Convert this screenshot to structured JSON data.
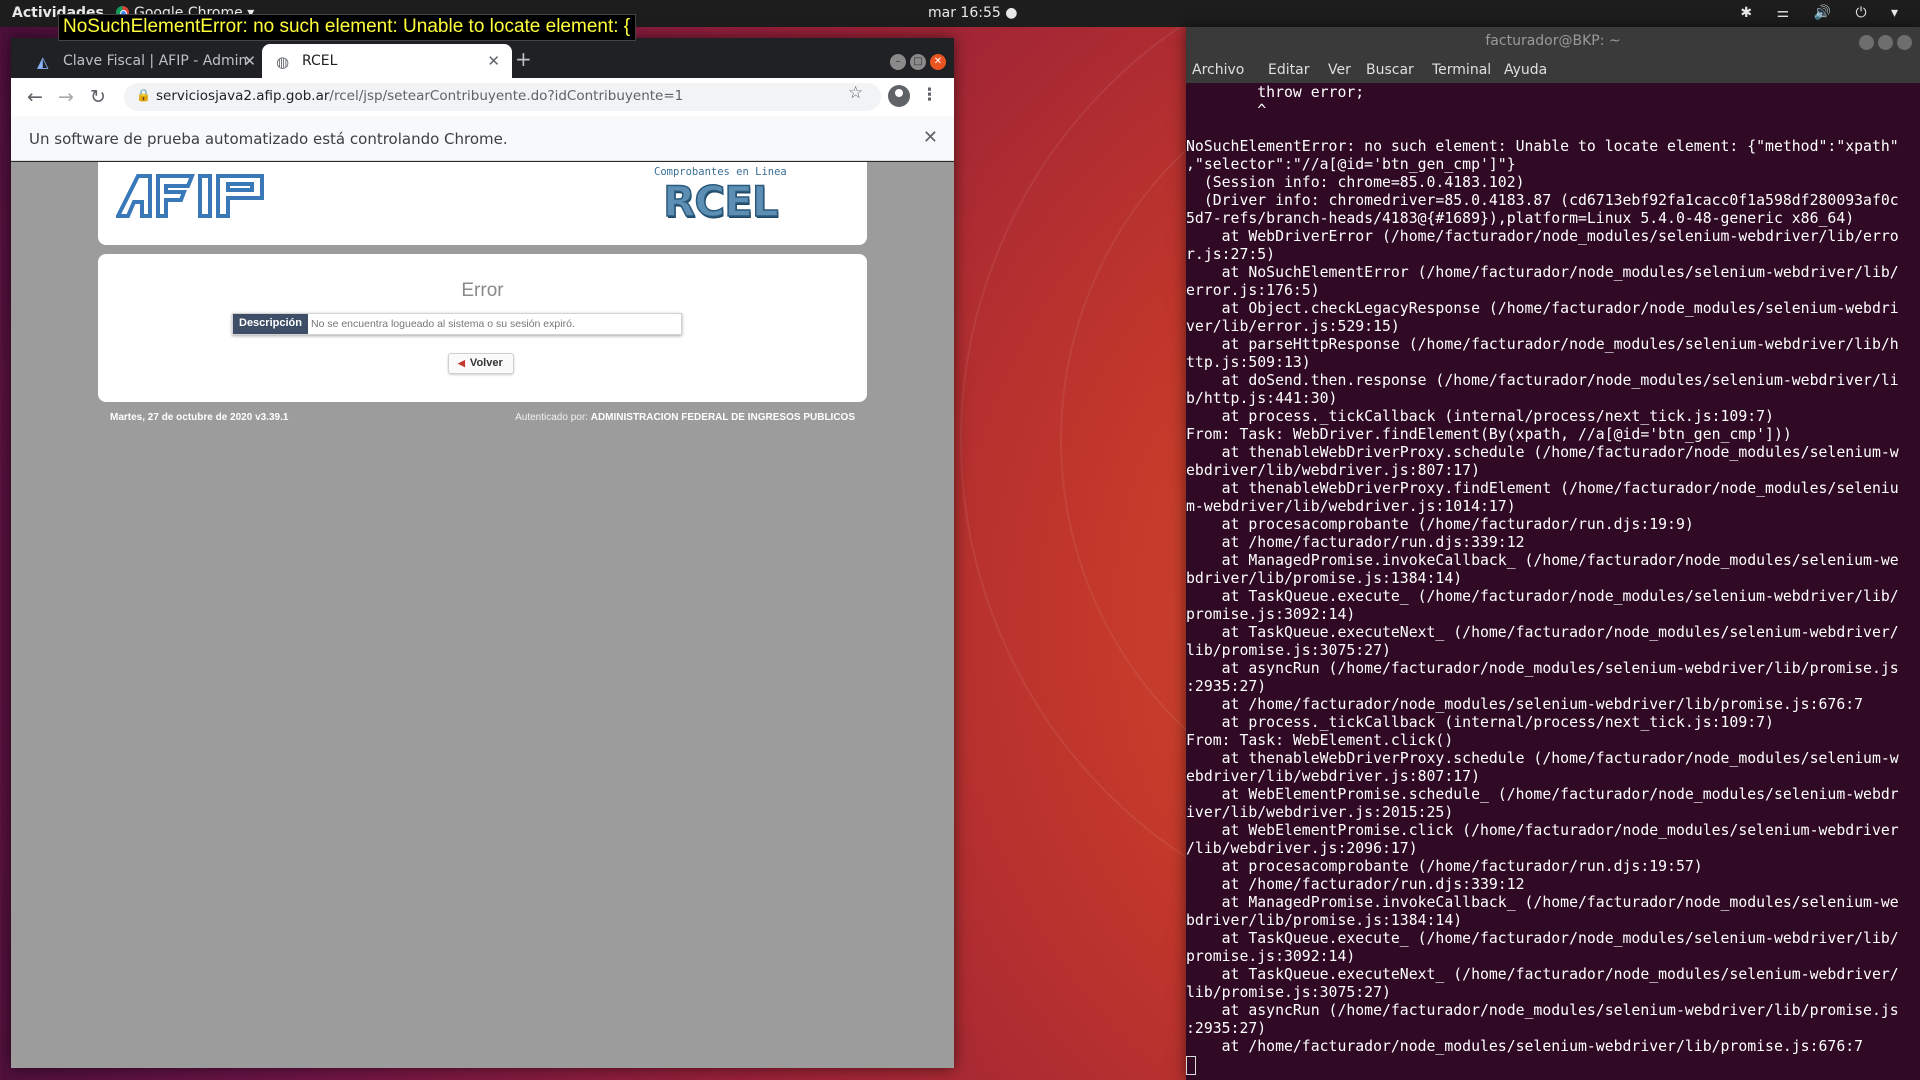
{
  "topbar": {
    "activities": "Actividades",
    "app_name": "Google Chrome",
    "clock": "mar 16:55 ●",
    "status_icons": "✱ ⚌ 🔊 ⏻ ▾"
  },
  "tooltip": "NoSuchElementError: no such element: Unable to locate element: {",
  "chrome": {
    "tabs": [
      {
        "label": "Clave Fiscal | AFIP - Admin",
        "close": "✕"
      },
      {
        "label": "RCEL",
        "close": "✕"
      }
    ],
    "new_tab": "+",
    "url_host": "serviciosjava2.afip.gob.ar",
    "url_path": "/rcel/jsp/setearContribuyente.do?idContribuyente=1",
    "infobar": "Un software de prueba automatizado está controlando Chrome.",
    "infobar_close": "✕"
  },
  "page": {
    "rcel_caption": "Comprobantes en Linea",
    "rcel_word": "RCEL",
    "error_title": "Error",
    "desc_label": "Descripción",
    "desc_text": "No se encuentra logueado al sistema o su sesión expiró.",
    "volver": "Volver",
    "footer_date": "Martes, 27 de octubre de 2020 v3.39.1",
    "footer_auth_prefix": "Autenticado por:",
    "footer_auth_org": "ADMINISTRACION FEDERAL DE INGRESOS PUBLICOS"
  },
  "terminal": {
    "title": "facturador@BKP: ~",
    "menu": [
      "Archivo",
      "Editar",
      "Ver",
      "Buscar",
      "Terminal",
      "Ayuda"
    ],
    "lines": [
      "        throw error;",
      "        ^",
      "",
      "NoSuchElementError: no such element: Unable to locate element: {\"method\":\"xpath\"",
      ",\"selector\":\"//a[@id='btn_gen_cmp']\"}",
      "  (Session info: chrome=85.0.4183.102)",
      "  (Driver info: chromedriver=85.0.4183.87 (cd6713ebf92fa1cacc0f1a598df280093af0c",
      "5d7-refs/branch-heads/4183@{#1689}),platform=Linux 5.4.0-48-generic x86_64)",
      "    at WebDriverError (/home/facturador/node_modules/selenium-webdriver/lib/erro",
      "r.js:27:5)",
      "    at NoSuchElementError (/home/facturador/node_modules/selenium-webdriver/lib/",
      "error.js:176:5)",
      "    at Object.checkLegacyResponse (/home/facturador/node_modules/selenium-webdri",
      "ver/lib/error.js:529:15)",
      "    at parseHttpResponse (/home/facturador/node_modules/selenium-webdriver/lib/h",
      "ttp.js:509:13)",
      "    at doSend.then.response (/home/facturador/node_modules/selenium-webdriver/li",
      "b/http.js:441:30)",
      "    at process._tickCallback (internal/process/next_tick.js:109:7)",
      "From: Task: WebDriver.findElement(By(xpath, //a[@id='btn_gen_cmp']))",
      "    at thenableWebDriverProxy.schedule (/home/facturador/node_modules/selenium-w",
      "ebdriver/lib/webdriver.js:807:17)",
      "    at thenableWebDriverProxy.findElement (/home/facturador/node_modules/seleniu",
      "m-webdriver/lib/webdriver.js:1014:17)",
      "    at procesacomprobante (/home/facturador/run.djs:19:9)",
      "    at /home/facturador/run.djs:339:12",
      "    at ManagedPromise.invokeCallback_ (/home/facturador/node_modules/selenium-we",
      "bdriver/lib/promise.js:1384:14)",
      "    at TaskQueue.execute_ (/home/facturador/node_modules/selenium-webdriver/lib/",
      "promise.js:3092:14)",
      "    at TaskQueue.executeNext_ (/home/facturador/node_modules/selenium-webdriver/",
      "lib/promise.js:3075:27)",
      "    at asyncRun (/home/facturador/node_modules/selenium-webdriver/lib/promise.js",
      ":2935:27)",
      "    at /home/facturador/node_modules/selenium-webdriver/lib/promise.js:676:7",
      "    at process._tickCallback (internal/process/next_tick.js:109:7)",
      "From: Task: WebElement.click()",
      "    at thenableWebDriverProxy.schedule (/home/facturador/node_modules/selenium-w",
      "ebdriver/lib/webdriver.js:807:17)",
      "    at WebElementPromise.schedule_ (/home/facturador/node_modules/selenium-webdr",
      "iver/lib/webdriver.js:2015:25)",
      "    at WebElementPromise.click (/home/facturador/node_modules/selenium-webdriver",
      "/lib/webdriver.js:2096:17)",
      "    at procesacomprobante (/home/facturador/run.djs:19:57)",
      "    at /home/facturador/run.djs:339:12",
      "    at ManagedPromise.invokeCallback_ (/home/facturador/node_modules/selenium-we",
      "bdriver/lib/promise.js:1384:14)",
      "    at TaskQueue.execute_ (/home/facturador/node_modules/selenium-webdriver/lib/",
      "promise.js:3092:14)",
      "    at TaskQueue.executeNext_ (/home/facturador/node_modules/selenium-webdriver/",
      "lib/promise.js:3075:27)",
      "    at asyncRun (/home/facturador/node_modules/selenium-webdriver/lib/promise.js",
      ":2935:27)",
      "    at /home/facturador/node_modules/selenium-webdriver/lib/promise.js:676:7"
    ]
  },
  "colors": {
    "terminal_bg": "#300a24",
    "tooltip_text": "#ffff3c",
    "afip_blue": "#3a79b8",
    "desc_label_bg": "#3e4e66"
  }
}
